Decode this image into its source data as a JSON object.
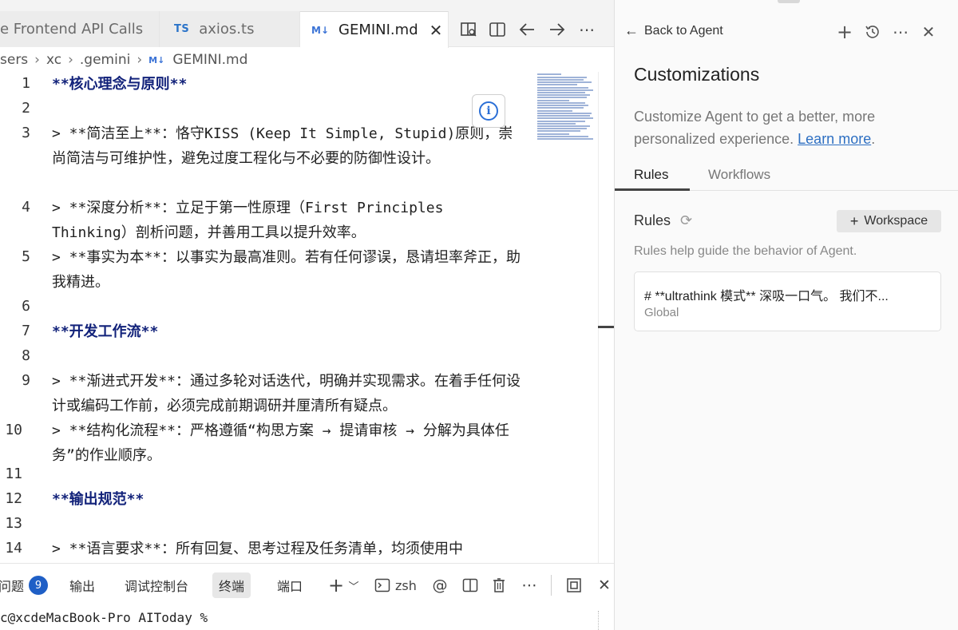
{
  "editor": {
    "tabs": [
      {
        "label": "e Frontend API Calls",
        "icon": "",
        "active": false
      },
      {
        "label": "axios.ts",
        "icon": "TS",
        "active": false
      },
      {
        "label": "GEMINI.md",
        "icon": "M↓",
        "active": true
      }
    ],
    "toolbar_icons": [
      "open-preview-icon",
      "split-editor-icon",
      "go-back-icon",
      "go-forward-icon",
      "more-icon"
    ],
    "breadcrumb": [
      "sers",
      "xc",
      ".gemini",
      "GEMINI.md"
    ],
    "breadcrumb_file_icon": "M↓",
    "info_icon": "i",
    "lines": [
      {
        "num": "1",
        "text": "**核心理念与原则**",
        "style": "heading"
      },
      {
        "num": "2",
        "text": "",
        "style": "blank"
      },
      {
        "num": "3",
        "text": "> **简洁至上**：恪守KISS (Keep It Simple, Stupid)原则，崇尚简洁与可维护性，避免过度工程化与不必要的防御性设计。",
        "style": "quote"
      },
      {
        "num": "4",
        "text": "> **深度分析**：立足于第一性原理（First Principles Thinking）剖析问题，并善用工具以提升效率。",
        "style": "quote"
      },
      {
        "num": "5",
        "text": "> **事实为本**：以事实为最高准则。若有任何谬误，恳请坦率斧正，助我精进。",
        "style": "quote"
      },
      {
        "num": "6",
        "text": "",
        "style": "blank"
      },
      {
        "num": "7",
        "text": "**开发工作流**",
        "style": "heading"
      },
      {
        "num": "8",
        "text": "",
        "style": "blank"
      },
      {
        "num": "9",
        "text": "> **渐进式开发**：通过多轮对话迭代，明确并实现需求。在着手任何设计或编码工作前，必须完成前期调研并厘清所有疑点。",
        "style": "quote"
      },
      {
        "num": "10",
        "text": "> **结构化流程**：严格遵循“构思方案 → 提请审核 → 分解为具体任务”的作业顺序。",
        "style": "quote"
      },
      {
        "num": "11",
        "text": "",
        "style": "blank"
      },
      {
        "num": "12",
        "text": "**输出规范**",
        "style": "heading"
      },
      {
        "num": "13",
        "text": "",
        "style": "blank"
      },
      {
        "num": "14",
        "text": "> **语言要求**：所有回复、思考过程及任务清单，均须使用中",
        "style": "quote"
      }
    ]
  },
  "panel": {
    "tabs": [
      {
        "label": "问题",
        "badge": "9",
        "active": false
      },
      {
        "label": "输出",
        "active": false
      },
      {
        "label": "调试控制台",
        "active": false
      },
      {
        "label": "终端",
        "active": true
      },
      {
        "label": "端口",
        "active": false
      }
    ],
    "shell_label": "zsh",
    "icons": [
      "new-terminal-icon",
      "dropdown-icon",
      "terminal-icon",
      "mention-icon",
      "split-terminal-icon",
      "trash-icon",
      "more-icon",
      "maximize-icon",
      "close-icon"
    ],
    "terminal_line": "c@xcdeMacBook-Pro AIToday %"
  },
  "agent": {
    "back_label": "Back to Agent",
    "title": "Customizations",
    "description": "Customize Agent to get a better, more personalized experience.",
    "learn_more": "Learn more",
    "period": ".",
    "tabs": [
      {
        "label": "Rules",
        "active": true
      },
      {
        "label": "Workflows",
        "active": false
      }
    ],
    "rules_heading": "Rules",
    "workspace_button": "Workspace",
    "rules_description": "Rules help guide the behavior of Agent.",
    "rule_card": {
      "title": "# **ultrathink 模式** 深吸一口气。 我们不...",
      "scope": "Global"
    }
  }
}
